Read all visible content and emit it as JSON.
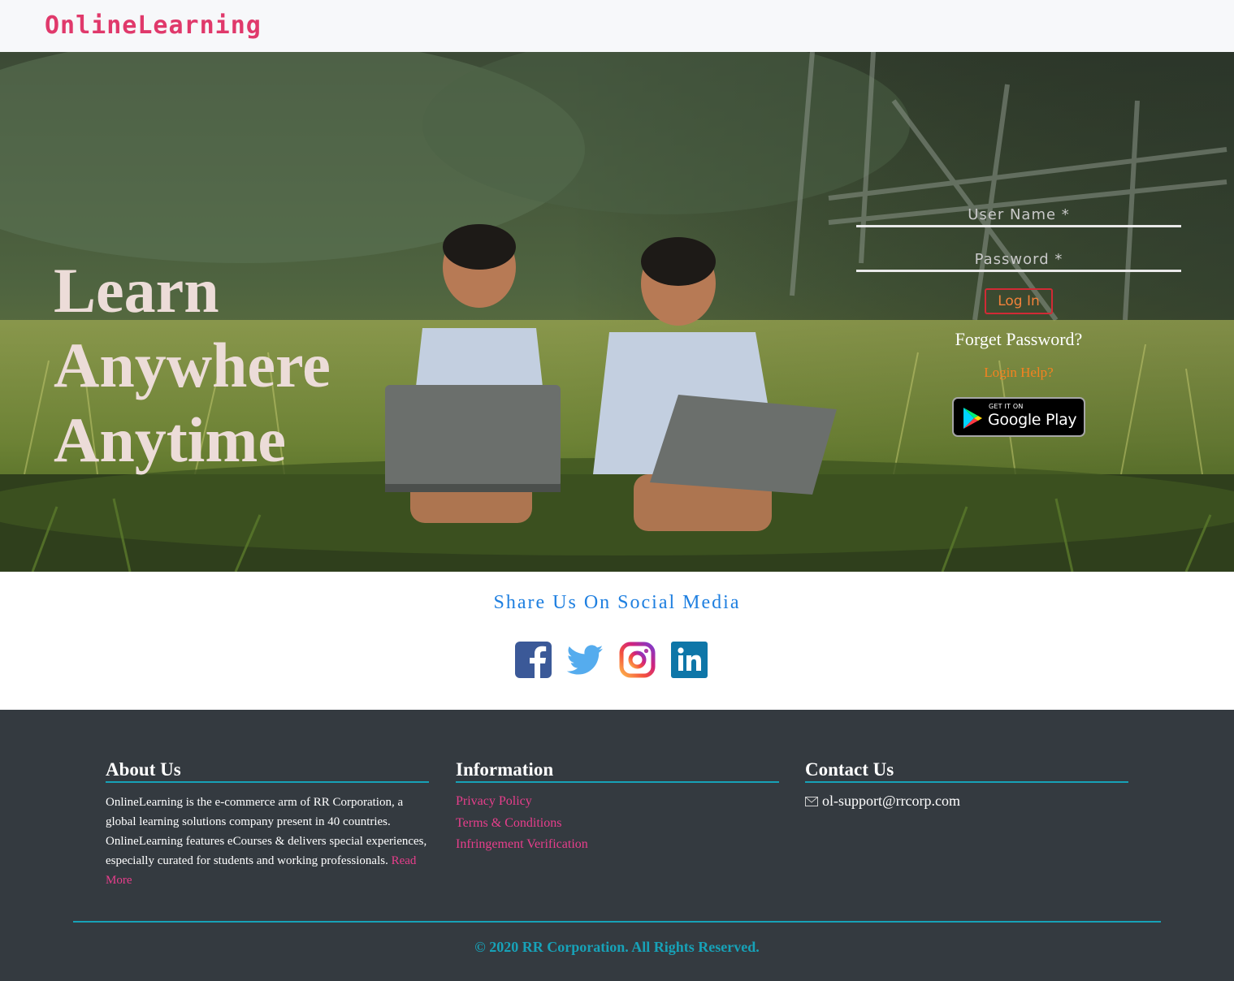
{
  "navbar": {
    "brand": "OnlineLearning"
  },
  "hero": {
    "headline": [
      "Learn",
      "Anywhere",
      "Anytime"
    ],
    "login": {
      "username_placeholder": "User Name *",
      "password_placeholder": "Password *",
      "login_button": "Log In",
      "forget_password": "Forget Password?",
      "login_help": "Login Help?",
      "google_play": {
        "small_text": "GET IT ON",
        "big_text": "Google Play"
      }
    }
  },
  "social": {
    "title": "Share Us On Social Media",
    "icons": [
      "facebook-icon",
      "twitter-icon",
      "instagram-icon",
      "linkedin-icon"
    ]
  },
  "footer": {
    "about": {
      "heading": "About Us",
      "text": "OnlineLearning is the e-commerce arm of RR Corporation, a global learning solutions company present in 40 countries. OnlineLearning features eCourses & delivers special experiences, especially curated for students and working professionals.",
      "read_more": "Read More"
    },
    "information": {
      "heading": "Information",
      "links": [
        "Privacy Policy",
        "Terms & Conditions",
        "Infringement Verification"
      ]
    },
    "contact": {
      "heading": "Contact Us",
      "email": "ol-support@rrcorp.com"
    },
    "copyright": "© 2020 RR Corporation. All Rights Reserved."
  },
  "colors": {
    "brand": "#e0396b",
    "accent_teal": "#17a2b8",
    "link_pink": "#e83e8c",
    "footer_bg": "#343a40",
    "social_title": "#1e7fe0",
    "login_border": "#d12a35",
    "login_text": "#f2823a",
    "help_text": "#f58220"
  }
}
